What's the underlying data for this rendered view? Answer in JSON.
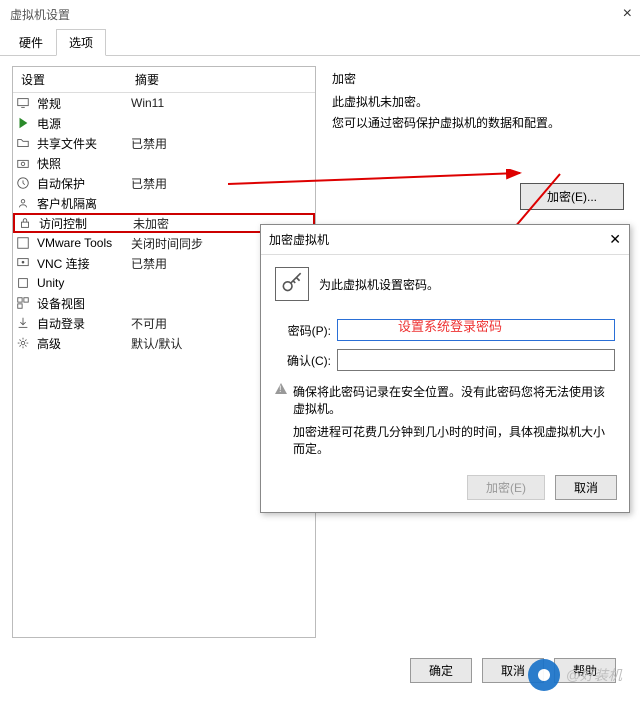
{
  "window": {
    "title": "虚拟机设置"
  },
  "tabs": {
    "hardware": "硬件",
    "options": "选项"
  },
  "list": {
    "header_setting": "设置",
    "header_summary": "摘要",
    "rows": [
      {
        "icon": "monitor-icon",
        "label": "常规",
        "summary": "Win11"
      },
      {
        "icon": "play-icon",
        "label": "电源",
        "summary": ""
      },
      {
        "icon": "folder-icon",
        "label": "共享文件夹",
        "summary": "已禁用"
      },
      {
        "icon": "camera-icon",
        "label": "快照",
        "summary": ""
      },
      {
        "icon": "clock-icon",
        "label": "自动保护",
        "summary": "已禁用"
      },
      {
        "icon": "guest-icon",
        "label": "客户机隔离",
        "summary": ""
      },
      {
        "icon": "lock-icon",
        "label": "访问控制",
        "summary": "未加密"
      },
      {
        "icon": "tools-icon",
        "label": "VMware Tools",
        "summary": "关闭时间同步"
      },
      {
        "icon": "vnc-icon",
        "label": "VNC 连接",
        "summary": "已禁用"
      },
      {
        "icon": "unity-icon",
        "label": "Unity",
        "summary": ""
      },
      {
        "icon": "view-icon",
        "label": "设备视图",
        "summary": ""
      },
      {
        "icon": "login-icon",
        "label": "自动登录",
        "summary": "不可用"
      },
      {
        "icon": "gear-icon",
        "label": "高级",
        "summary": "默认/默认"
      }
    ]
  },
  "right": {
    "title": "加密",
    "line1": "此虚拟机未加密。",
    "line2": "您可以通过密码保护虚拟机的数据和配置。",
    "encrypt_button": "加密(E)..."
  },
  "dialog": {
    "title": "加密虚拟机",
    "instruction": "为此虚拟机设置密码。",
    "password_label": "密码(P):",
    "confirm_label": "确认(C):",
    "placeholder_annotation": "设置系统登录密码",
    "warning": "确保将此密码记录在安全位置。没有此密码您将无法使用该虚拟机。",
    "note": "加密进程可花费几分钟到几小时的时间，具体视虚拟机大小而定。",
    "encrypt": "加密(E)",
    "cancel": "取消"
  },
  "buttons": {
    "ok": "确定",
    "cancel": "取消",
    "help": "帮助"
  },
  "watermark": "@好装机"
}
